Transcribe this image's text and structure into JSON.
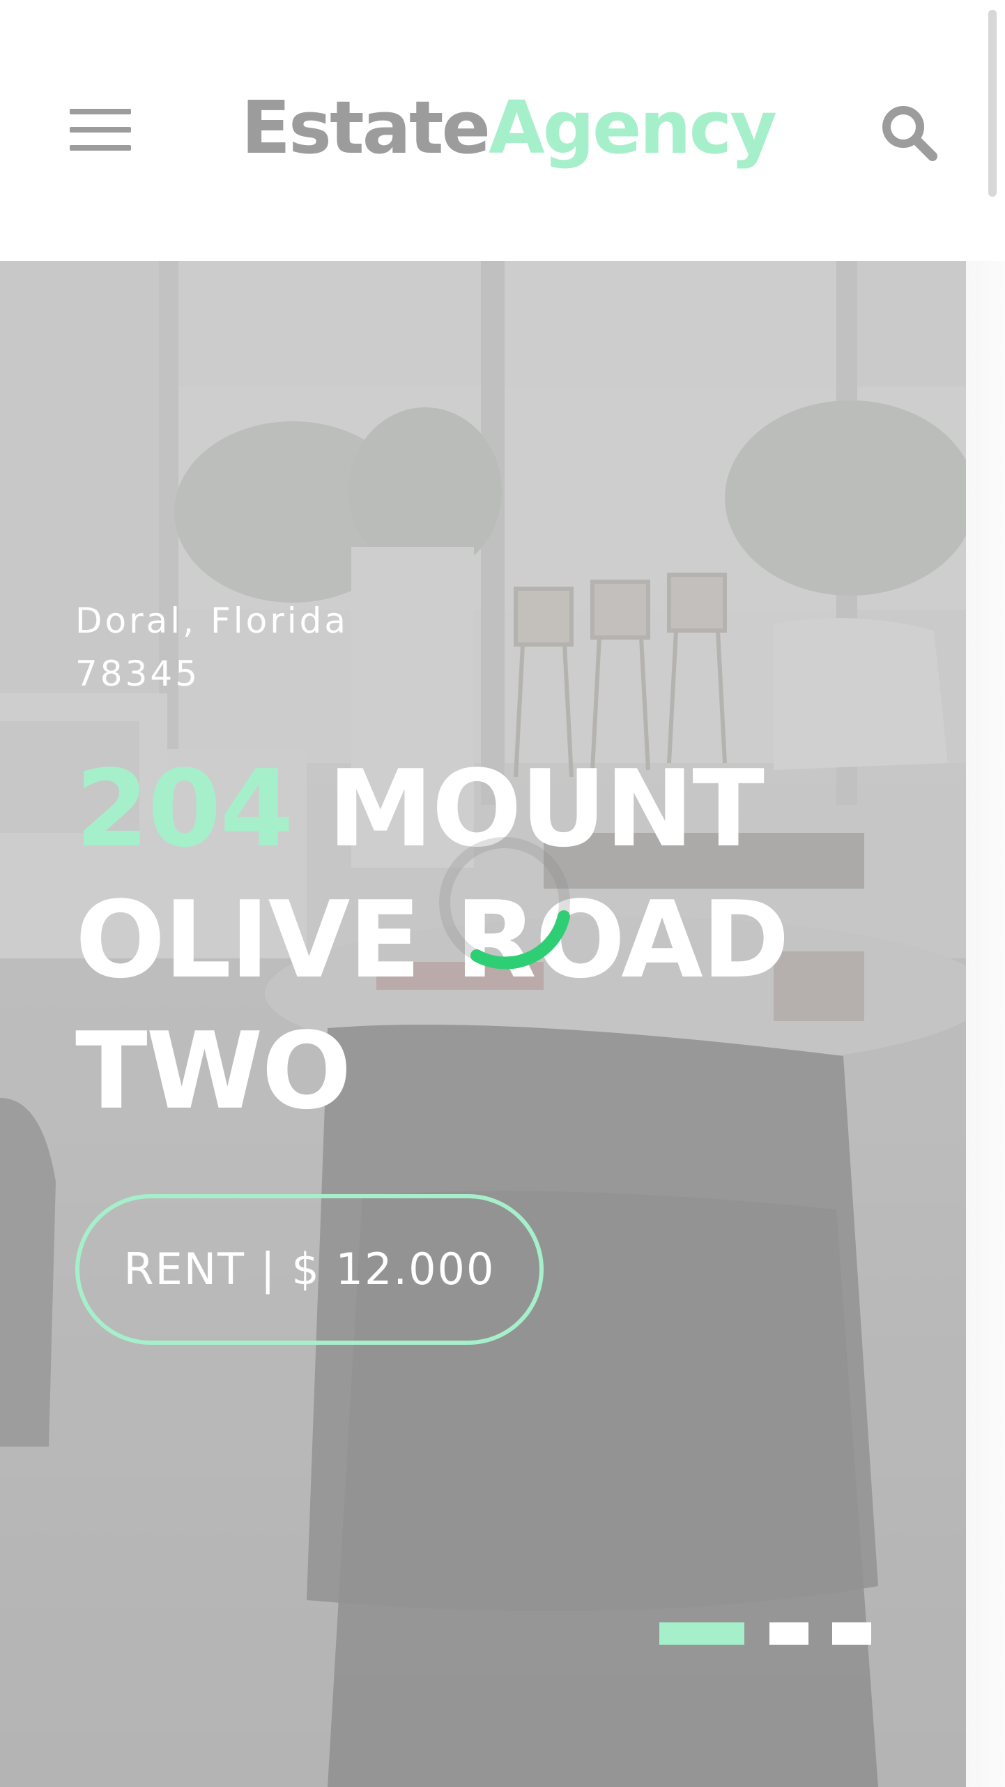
{
  "header": {
    "logo_primary": "Estate",
    "logo_accent": "Agency",
    "menu_icon": "hamburger-menu-icon",
    "search_icon": "search-icon"
  },
  "hero": {
    "address_line1": "Doral, Florida",
    "address_line2": "78345",
    "title_number": "204",
    "title_word1": "MOUNT",
    "title_line2": "OLIVE ROAD",
    "title_line3": "TWO",
    "price_label": "RENT | $ 12.000",
    "carousel": {
      "slides": 3,
      "active_index": 1
    },
    "loading_icon": "loading-spinner-icon"
  },
  "colors": {
    "accent": "#a6efcb",
    "logo_gray": "#9c9c9c",
    "spinner_green": "#2ecf74",
    "white": "#ffffff"
  }
}
